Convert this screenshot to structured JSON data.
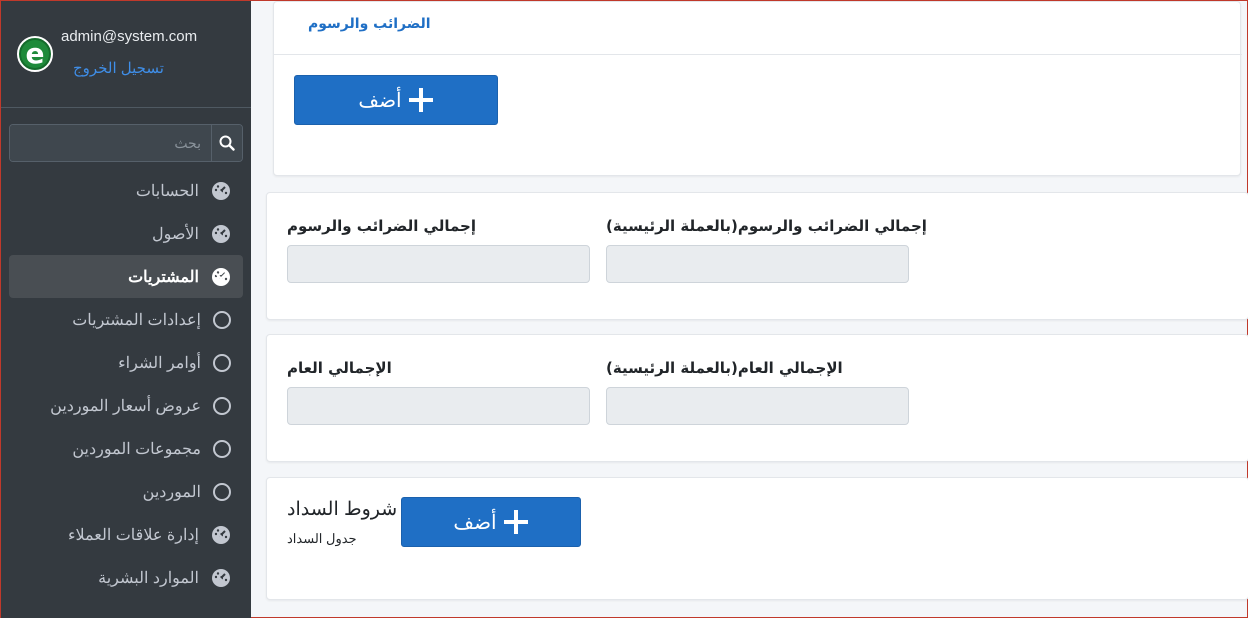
{
  "sidebar": {
    "email": "admin@system.com",
    "logout": "تسجيل الخروج",
    "search_placeholder": "بحث",
    "items": [
      {
        "label": "الحسابات",
        "icon": "gauge-icon",
        "chevron": "chevron-left-icon"
      },
      {
        "label": "الأصول",
        "icon": "gauge-icon",
        "chevron": "chevron-left-icon"
      },
      {
        "label": "المشتريات",
        "icon": "gauge-icon",
        "chevron": "chevron-down-icon",
        "active": true
      },
      {
        "label": "إعدادات المشتريات",
        "icon": "circle-icon"
      },
      {
        "label": "أوامر الشراء",
        "icon": "circle-icon"
      },
      {
        "label": "عروض أسعار الموردين",
        "icon": "circle-icon"
      },
      {
        "label": "مجموعات الموردين",
        "icon": "circle-icon"
      },
      {
        "label": "الموردين",
        "icon": "circle-icon"
      },
      {
        "label": "إدارة علاقات العملاء",
        "icon": "gauge-icon",
        "chevron": "chevron-left-icon"
      },
      {
        "label": "الموارد البشرية",
        "icon": "gauge-icon",
        "chevron": "chevron-left-icon"
      }
    ]
  },
  "main": {
    "taxes_tab": "الضرائب والرسوم",
    "add_label": "أضف",
    "totals_taxes": {
      "base_currency_label": "إجمالي الضرائب والرسوم(بالعملة الرئيسية)",
      "label": "إجمالي الضرائب والرسوم",
      "base_currency_value": "",
      "value": ""
    },
    "grand_total": {
      "base_currency_label": "الإجمالي العام(بالعملة الرئيسية)",
      "label": "الإجمالي العام",
      "base_currency_value": "",
      "value": ""
    },
    "payment_terms": {
      "title": "شروط السداد",
      "subtitle": "جدول السداد",
      "add_label": "أضف"
    }
  },
  "colors": {
    "sidebar_bg": "#343a40",
    "accent": "#1f6fc5",
    "logout_link": "#3f8ee8"
  }
}
